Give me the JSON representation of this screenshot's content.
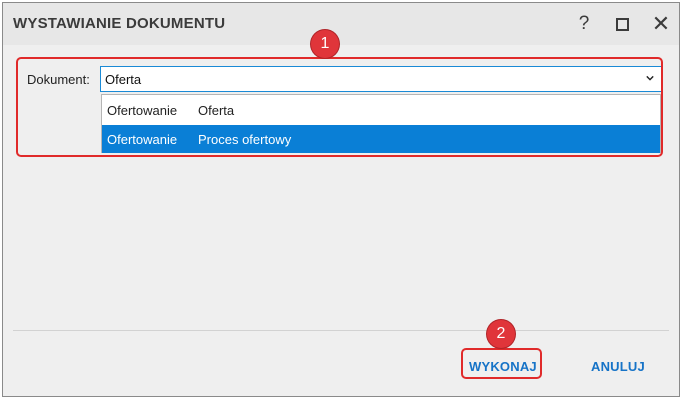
{
  "dialog": {
    "title": "WYSTAWIANIE DOKUMENTU",
    "help_glyph": "?",
    "close_glyph": "✕"
  },
  "form": {
    "document_label": "Dokument:",
    "document_value": "Oferta",
    "options": [
      {
        "category": "Ofertowanie",
        "name": "Oferta",
        "selected": false
      },
      {
        "category": "Ofertowanie",
        "name": "Proces ofertowy",
        "selected": true
      }
    ]
  },
  "annotations": {
    "badge_1": "1",
    "badge_2": "2",
    "color": "#e0353a"
  },
  "footer": {
    "execute_label": "WYKONAJ",
    "cancel_label": "ANULUJ"
  },
  "colors": {
    "accent": "#1673c7",
    "selection": "#0a7fd6",
    "highlight": "#e02a2a"
  }
}
